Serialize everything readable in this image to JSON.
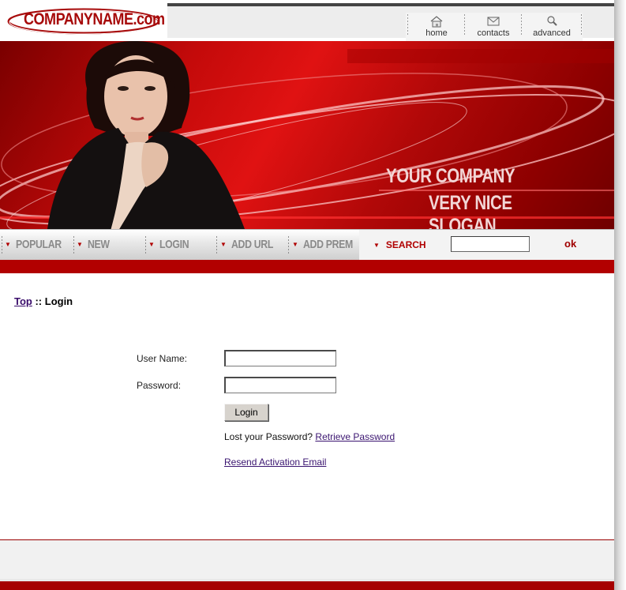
{
  "header": {
    "logo_text": "COMPANYNAME.com",
    "nav": [
      {
        "label": "home",
        "icon": "house-icon"
      },
      {
        "label": "contacts",
        "icon": "envelope-icon"
      },
      {
        "label": "advanced",
        "icon": "magnifier-icon"
      }
    ]
  },
  "banner": {
    "slogan_line1": "YOUR COMPANY",
    "slogan_line2": "VERY NICE SLOGAN"
  },
  "menu": {
    "items": [
      "POPULAR",
      "NEW",
      "LOGIN",
      "ADD URL",
      "ADD PREM"
    ],
    "search_label": "SEARCH",
    "search_value": "",
    "search_button": "ok"
  },
  "breadcrumb": {
    "top_link": "Top",
    "separator": " :: ",
    "current": "Login"
  },
  "login_form": {
    "username_label": "User Name:",
    "username_value": "",
    "password_label": "Password:",
    "password_value": "",
    "submit_label": "Login",
    "lost_text": "Lost your Password?",
    "retrieve_link": "Retrieve Password",
    "resend_link": "Resend Activation Email"
  },
  "colors": {
    "brand_red": "#b20000",
    "link": "#3a1470"
  }
}
